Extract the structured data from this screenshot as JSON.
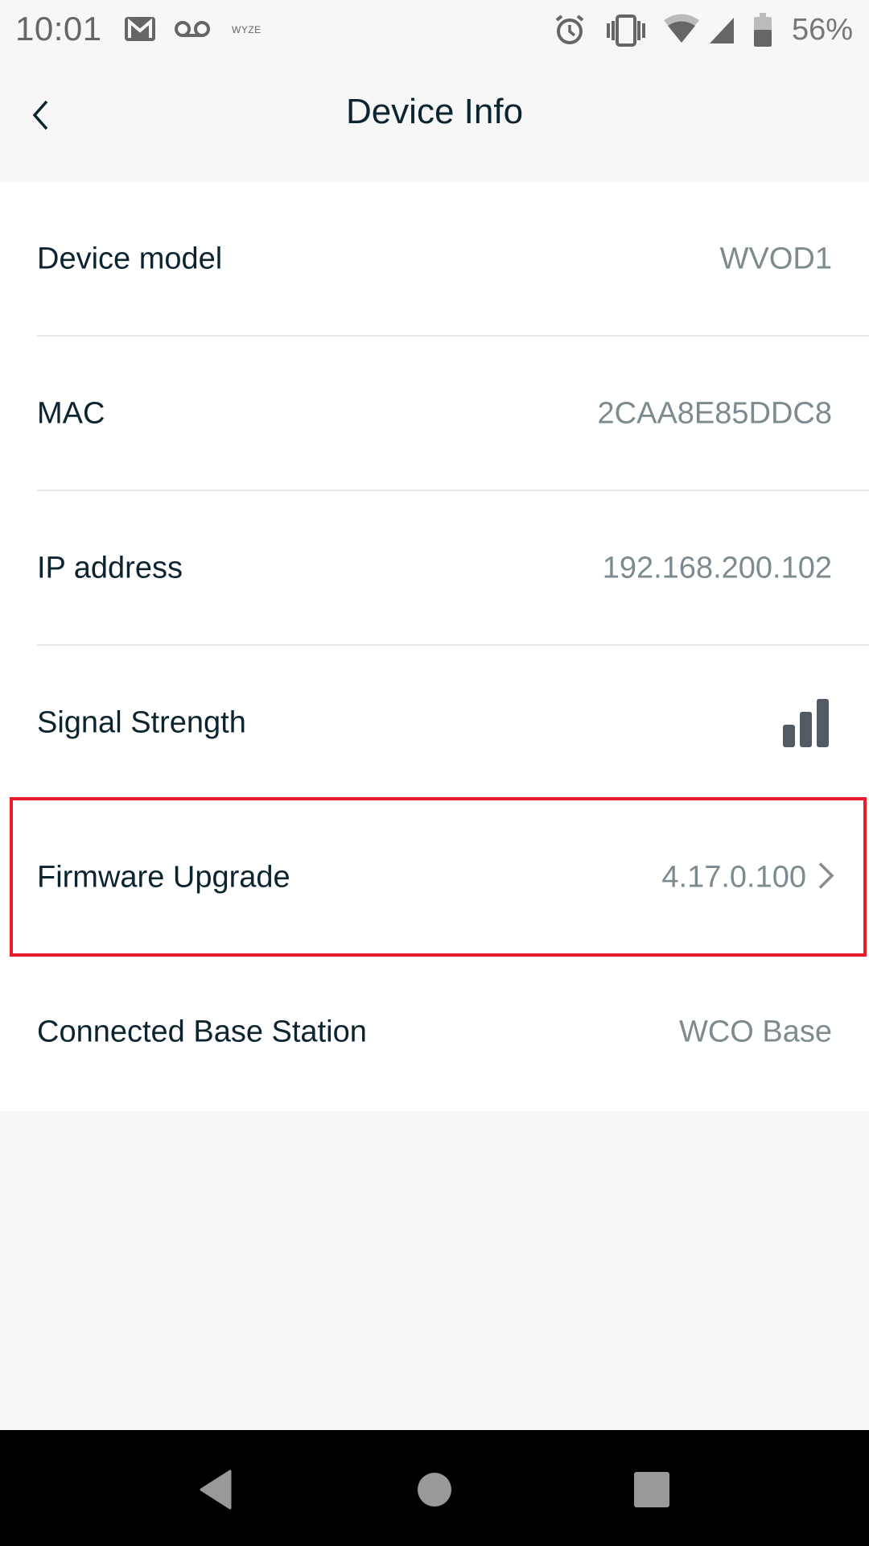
{
  "status_bar": {
    "time": "10:01",
    "notification_icons": [
      "gmail-icon",
      "voicemail-icon",
      "wyze-icon"
    ],
    "wyze_label": "WYZE",
    "system_icons": [
      "alarm-icon",
      "vibrate-icon",
      "wifi-icon",
      "cell-signal-icon",
      "battery-icon"
    ],
    "battery_percent": "56%",
    "battery_level": 0.56
  },
  "header": {
    "title": "Device Info",
    "back_icon": "chevron-left-icon"
  },
  "rows": [
    {
      "label": "Device model",
      "value": "WVOD1"
    },
    {
      "label": "MAC",
      "value": "2CAA8E85DDC8"
    },
    {
      "label": "IP address",
      "value": "192.168.200.102"
    },
    {
      "label": "Signal Strength",
      "value_icon": "signal-strength-icon",
      "signal_level": "3 of 3 bars"
    },
    {
      "label": "Firmware Upgrade",
      "value": "4.17.0.100",
      "trailing_icon": "chevron-right-icon"
    },
    {
      "label": "Connected Base Station",
      "value": "WCO Base"
    }
  ],
  "highlight": {
    "target": "Firmware Upgrade",
    "color": "#e81c2a"
  },
  "colors": {
    "label_text": "#0b2430",
    "value_text": "#7d8b91",
    "signal_bars": "#525a63",
    "page_bg": "#f7f7f7",
    "list_bg": "#ffffff"
  },
  "nav_bar": {
    "buttons": [
      "back",
      "home",
      "recents"
    ]
  }
}
